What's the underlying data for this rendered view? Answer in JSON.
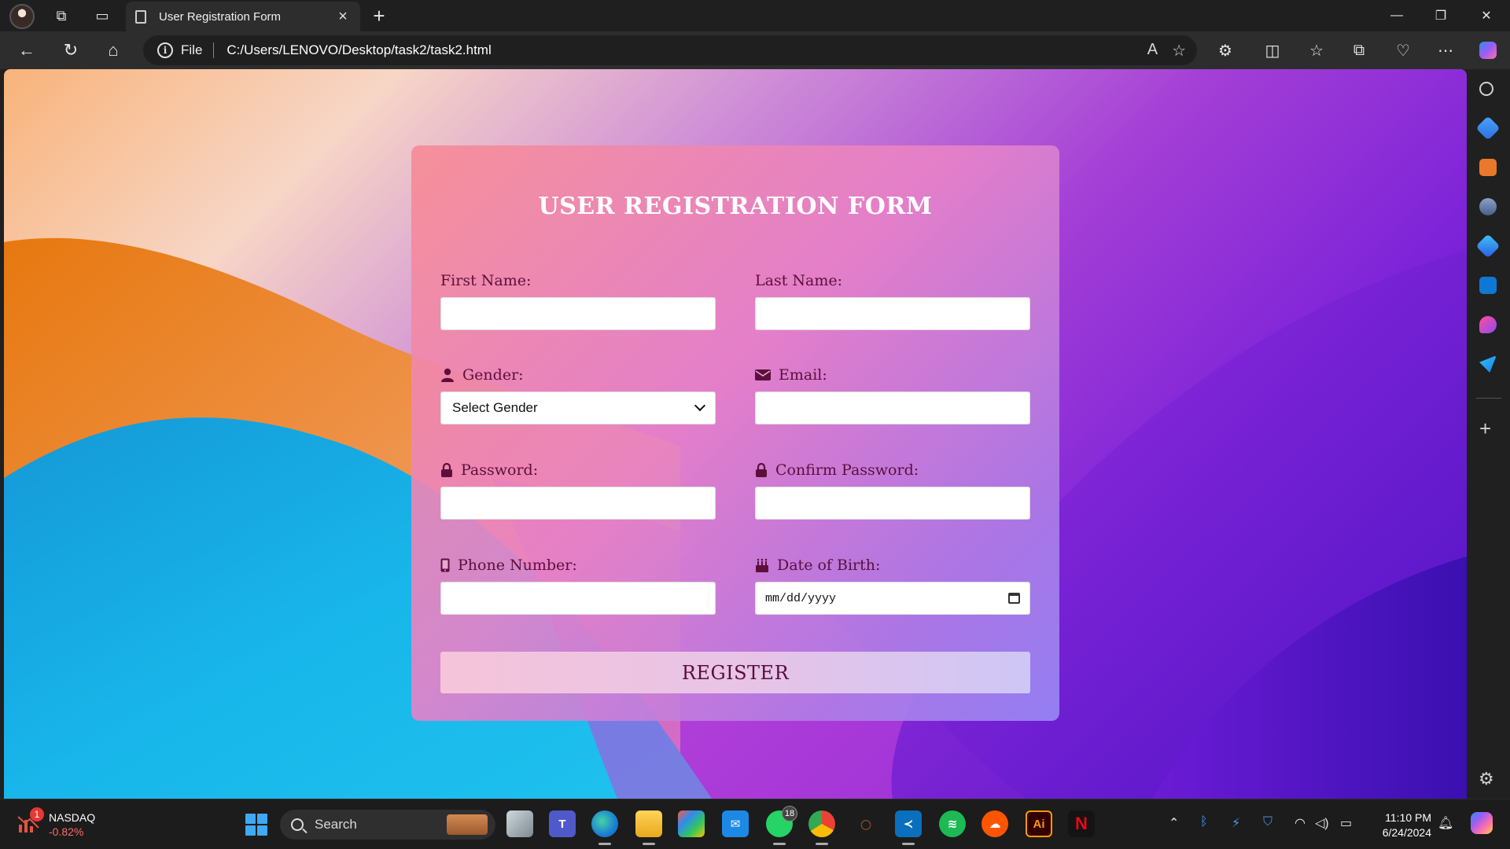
{
  "browser": {
    "tab_title": "User Registration Form",
    "address_scheme_label": "File",
    "url": "C:/Users/LENOVO/Desktop/task2/task2.html"
  },
  "form": {
    "title": "USER REGISTRATION FORM",
    "fields": {
      "first_name": {
        "label": "First Name:",
        "value": ""
      },
      "last_name": {
        "label": "Last Name:",
        "value": ""
      },
      "gender": {
        "label": "Gender:",
        "selected": "Select Gender",
        "icon": "user-icon"
      },
      "email": {
        "label": "Email:",
        "value": "",
        "icon": "envelope-icon"
      },
      "password": {
        "label": "Password:",
        "value": "",
        "icon": "lock-icon"
      },
      "confirm_password": {
        "label": "Confirm Password:",
        "value": "",
        "icon": "lock-icon"
      },
      "phone": {
        "label": "Phone Number:",
        "value": "",
        "icon": "mobile-icon"
      },
      "dob": {
        "label": "Date of Birth:",
        "placeholder": "mm/dd/yyyy",
        "icon": "birthday-cake-icon"
      }
    },
    "submit_label": "REGISTER"
  },
  "taskbar": {
    "stock_name": "NASDAQ",
    "stock_change": "-0.82%",
    "stock_badge": "1",
    "search_label": "Search",
    "whatsapp_badge": "18",
    "time": "11:10 PM",
    "date": "6/24/2024"
  },
  "colors": {
    "label_text": "#5c0f3c",
    "card_gradient_start": "#f68c96",
    "card_gradient_end": "#9687f5",
    "title_text": "#ffffff"
  }
}
